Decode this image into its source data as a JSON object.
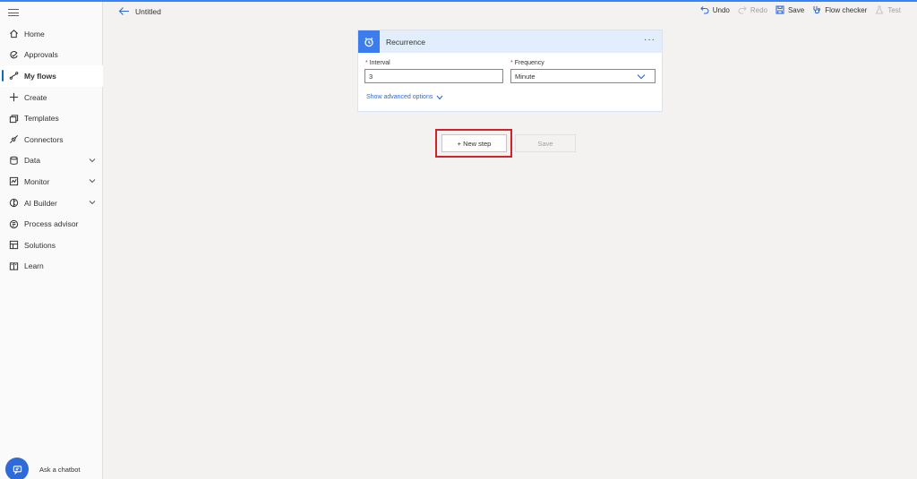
{
  "app": {
    "accent": "#2f6bd8",
    "highlight": "#d0222b"
  },
  "sidebar": {
    "items": [
      {
        "label": "Home",
        "icon": "home-icon",
        "active": false,
        "expandable": false
      },
      {
        "label": "Approvals",
        "icon": "approvals-icon",
        "active": false,
        "expandable": false
      },
      {
        "label": "My flows",
        "icon": "flows-icon",
        "active": true,
        "expandable": false
      },
      {
        "label": "Create",
        "icon": "plus-icon",
        "active": false,
        "expandable": false
      },
      {
        "label": "Templates",
        "icon": "templates-icon",
        "active": false,
        "expandable": false
      },
      {
        "label": "Connectors",
        "icon": "connectors-icon",
        "active": false,
        "expandable": false
      },
      {
        "label": "Data",
        "icon": "database-icon",
        "active": false,
        "expandable": true
      },
      {
        "label": "Monitor",
        "icon": "monitor-icon",
        "active": false,
        "expandable": true
      },
      {
        "label": "AI Builder",
        "icon": "ai-builder-icon",
        "active": false,
        "expandable": true
      },
      {
        "label": "Process advisor",
        "icon": "process-advisor-icon",
        "active": false,
        "expandable": false
      },
      {
        "label": "Solutions",
        "icon": "solutions-icon",
        "active": false,
        "expandable": false
      },
      {
        "label": "Learn",
        "icon": "book-icon",
        "active": false,
        "expandable": false
      }
    ],
    "chatbot_label": "Ask a chatbot"
  },
  "header": {
    "title": "Untitled",
    "commands": {
      "undo": "Undo",
      "redo": "Redo",
      "save": "Save",
      "flow_checker": "Flow checker",
      "test": "Test"
    }
  },
  "card": {
    "title": "Recurrence",
    "more": "···",
    "interval_label": "Interval",
    "interval_value": "3",
    "frequency_label": "Frequency",
    "frequency_value": "Minute",
    "required_mark": "*",
    "advanced_label": "Show advanced options"
  },
  "actions": {
    "new_step": "+ New step",
    "save": "Save"
  }
}
